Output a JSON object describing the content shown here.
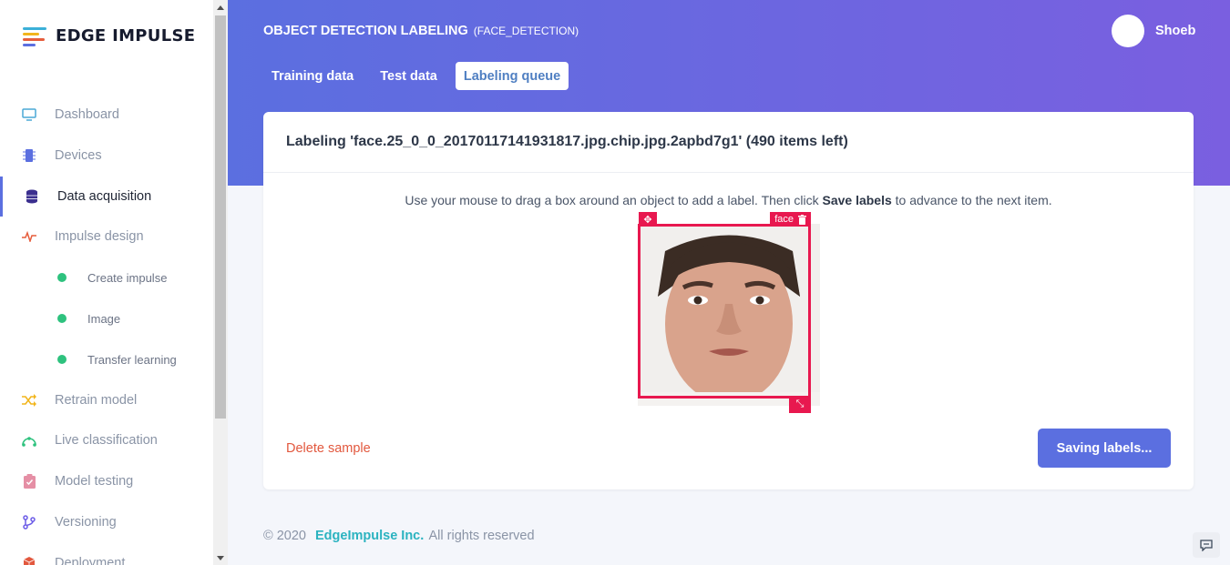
{
  "app": {
    "name": "EDGE IMPULSE"
  },
  "sidebar": {
    "items": [
      {
        "label": "Dashboard",
        "icon": "monitor-icon"
      },
      {
        "label": "Devices",
        "icon": "chip-icon"
      },
      {
        "label": "Data acquisition",
        "icon": "database-icon",
        "active": true
      },
      {
        "label": "Impulse design",
        "icon": "pulse-icon"
      },
      {
        "label": "Create impulse",
        "sub": true
      },
      {
        "label": "Image",
        "sub": true
      },
      {
        "label": "Transfer learning",
        "sub": true
      },
      {
        "label": "Retrain model",
        "icon": "shuffle-icon"
      },
      {
        "label": "Live classification",
        "icon": "live-icon"
      },
      {
        "label": "Model testing",
        "icon": "clipboard-check-icon"
      },
      {
        "label": "Versioning",
        "icon": "branch-icon"
      },
      {
        "label": "Deployment",
        "icon": "box-icon"
      }
    ]
  },
  "header": {
    "title": "OBJECT DETECTION LABELING",
    "subtitle": "(FACE_DETECTION)",
    "user": "Shoeb",
    "tabs": [
      {
        "label": "Training data",
        "active": false
      },
      {
        "label": "Test data",
        "active": false
      },
      {
        "label": "Labeling queue",
        "active": true
      }
    ]
  },
  "card": {
    "title": "Labeling 'face.25_0_0_20170117141931817.jpg.chip.jpg.2apbd7g1' (490 items left)",
    "instruction_pre": "Use your mouse to drag a box around an object to add a label. Then click ",
    "instruction_bold": "Save labels",
    "instruction_post": " to advance to the next item.",
    "bbox_label": "face",
    "delete_label": "Delete sample",
    "save_label": "Saving labels..."
  },
  "footer": {
    "copyright": "© 2020",
    "brand": "EdgeImpulse Inc.",
    "rights": "All rights reserved"
  },
  "colors": {
    "accent": "#5b6fe0",
    "bbox": "#e8184f",
    "delete": "#e2583e",
    "active_dot": "#2ec27e"
  }
}
